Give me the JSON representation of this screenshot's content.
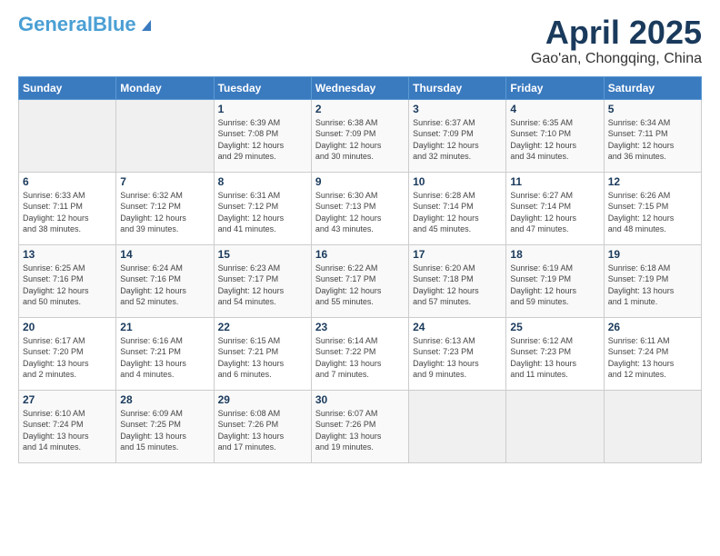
{
  "header": {
    "logo_general": "General",
    "logo_blue": "Blue",
    "month_title": "April 2025",
    "location": "Gao'an, Chongqing, China"
  },
  "days_of_week": [
    "Sunday",
    "Monday",
    "Tuesday",
    "Wednesday",
    "Thursday",
    "Friday",
    "Saturday"
  ],
  "weeks": [
    [
      {
        "day": "",
        "detail": ""
      },
      {
        "day": "",
        "detail": ""
      },
      {
        "day": "1",
        "detail": "Sunrise: 6:39 AM\nSunset: 7:08 PM\nDaylight: 12 hours\nand 29 minutes."
      },
      {
        "day": "2",
        "detail": "Sunrise: 6:38 AM\nSunset: 7:09 PM\nDaylight: 12 hours\nand 30 minutes."
      },
      {
        "day": "3",
        "detail": "Sunrise: 6:37 AM\nSunset: 7:09 PM\nDaylight: 12 hours\nand 32 minutes."
      },
      {
        "day": "4",
        "detail": "Sunrise: 6:35 AM\nSunset: 7:10 PM\nDaylight: 12 hours\nand 34 minutes."
      },
      {
        "day": "5",
        "detail": "Sunrise: 6:34 AM\nSunset: 7:11 PM\nDaylight: 12 hours\nand 36 minutes."
      }
    ],
    [
      {
        "day": "6",
        "detail": "Sunrise: 6:33 AM\nSunset: 7:11 PM\nDaylight: 12 hours\nand 38 minutes."
      },
      {
        "day": "7",
        "detail": "Sunrise: 6:32 AM\nSunset: 7:12 PM\nDaylight: 12 hours\nand 39 minutes."
      },
      {
        "day": "8",
        "detail": "Sunrise: 6:31 AM\nSunset: 7:12 PM\nDaylight: 12 hours\nand 41 minutes."
      },
      {
        "day": "9",
        "detail": "Sunrise: 6:30 AM\nSunset: 7:13 PM\nDaylight: 12 hours\nand 43 minutes."
      },
      {
        "day": "10",
        "detail": "Sunrise: 6:28 AM\nSunset: 7:14 PM\nDaylight: 12 hours\nand 45 minutes."
      },
      {
        "day": "11",
        "detail": "Sunrise: 6:27 AM\nSunset: 7:14 PM\nDaylight: 12 hours\nand 47 minutes."
      },
      {
        "day": "12",
        "detail": "Sunrise: 6:26 AM\nSunset: 7:15 PM\nDaylight: 12 hours\nand 48 minutes."
      }
    ],
    [
      {
        "day": "13",
        "detail": "Sunrise: 6:25 AM\nSunset: 7:16 PM\nDaylight: 12 hours\nand 50 minutes."
      },
      {
        "day": "14",
        "detail": "Sunrise: 6:24 AM\nSunset: 7:16 PM\nDaylight: 12 hours\nand 52 minutes."
      },
      {
        "day": "15",
        "detail": "Sunrise: 6:23 AM\nSunset: 7:17 PM\nDaylight: 12 hours\nand 54 minutes."
      },
      {
        "day": "16",
        "detail": "Sunrise: 6:22 AM\nSunset: 7:17 PM\nDaylight: 12 hours\nand 55 minutes."
      },
      {
        "day": "17",
        "detail": "Sunrise: 6:20 AM\nSunset: 7:18 PM\nDaylight: 12 hours\nand 57 minutes."
      },
      {
        "day": "18",
        "detail": "Sunrise: 6:19 AM\nSunset: 7:19 PM\nDaylight: 12 hours\nand 59 minutes."
      },
      {
        "day": "19",
        "detail": "Sunrise: 6:18 AM\nSunset: 7:19 PM\nDaylight: 13 hours\nand 1 minute."
      }
    ],
    [
      {
        "day": "20",
        "detail": "Sunrise: 6:17 AM\nSunset: 7:20 PM\nDaylight: 13 hours\nand 2 minutes."
      },
      {
        "day": "21",
        "detail": "Sunrise: 6:16 AM\nSunset: 7:21 PM\nDaylight: 13 hours\nand 4 minutes."
      },
      {
        "day": "22",
        "detail": "Sunrise: 6:15 AM\nSunset: 7:21 PM\nDaylight: 13 hours\nand 6 minutes."
      },
      {
        "day": "23",
        "detail": "Sunrise: 6:14 AM\nSunset: 7:22 PM\nDaylight: 13 hours\nand 7 minutes."
      },
      {
        "day": "24",
        "detail": "Sunrise: 6:13 AM\nSunset: 7:23 PM\nDaylight: 13 hours\nand 9 minutes."
      },
      {
        "day": "25",
        "detail": "Sunrise: 6:12 AM\nSunset: 7:23 PM\nDaylight: 13 hours\nand 11 minutes."
      },
      {
        "day": "26",
        "detail": "Sunrise: 6:11 AM\nSunset: 7:24 PM\nDaylight: 13 hours\nand 12 minutes."
      }
    ],
    [
      {
        "day": "27",
        "detail": "Sunrise: 6:10 AM\nSunset: 7:24 PM\nDaylight: 13 hours\nand 14 minutes."
      },
      {
        "day": "28",
        "detail": "Sunrise: 6:09 AM\nSunset: 7:25 PM\nDaylight: 13 hours\nand 15 minutes."
      },
      {
        "day": "29",
        "detail": "Sunrise: 6:08 AM\nSunset: 7:26 PM\nDaylight: 13 hours\nand 17 minutes."
      },
      {
        "day": "30",
        "detail": "Sunrise: 6:07 AM\nSunset: 7:26 PM\nDaylight: 13 hours\nand 19 minutes."
      },
      {
        "day": "",
        "detail": ""
      },
      {
        "day": "",
        "detail": ""
      },
      {
        "day": "",
        "detail": ""
      }
    ]
  ]
}
